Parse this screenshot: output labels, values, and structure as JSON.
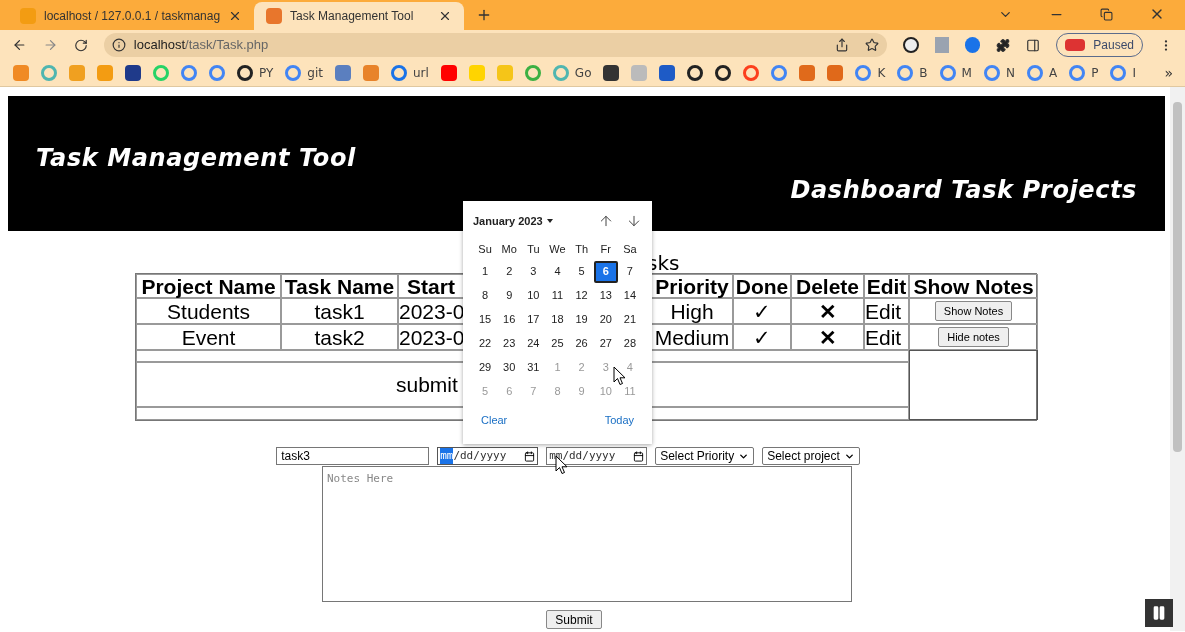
{
  "browser": {
    "tabs": [
      {
        "title": "localhost / 127.0.0.1 / taskmanag",
        "selected": false
      },
      {
        "title": "Task Management Tool",
        "selected": true
      }
    ],
    "address": {
      "host": "localhost",
      "path": "/task/Task.php"
    },
    "profile": {
      "label": "Paused"
    },
    "bookmarks": [
      {
        "kind": "square",
        "color": "#f08a24"
      },
      {
        "kind": "circle",
        "color": "#4fb6b0"
      },
      {
        "kind": "square",
        "color": "#f0a020"
      },
      {
        "kind": "square",
        "color": "#f39c12"
      },
      {
        "kind": "square",
        "color": "#1f3a8a"
      },
      {
        "kind": "circle",
        "color": "#25d366"
      },
      {
        "kind": "circle",
        "color": "#4285f4"
      },
      {
        "kind": "circle",
        "color": "#4285f4"
      },
      {
        "kind": "circle",
        "color": "#222222",
        "label": "PY"
      },
      {
        "kind": "circle",
        "color": "#4285f4",
        "label": "git"
      },
      {
        "kind": "square",
        "color": "#5b7fbf"
      },
      {
        "kind": "square",
        "color": "#e8832a"
      },
      {
        "kind": "circle",
        "color": "#1a73e8",
        "label": "url"
      },
      {
        "kind": "square",
        "color": "#ff0000"
      },
      {
        "kind": "square",
        "color": "#ffd400"
      },
      {
        "kind": "square",
        "color": "#f5c518"
      },
      {
        "kind": "circle",
        "color": "#3cb043"
      },
      {
        "kind": "circle",
        "color": "#4fb6b0",
        "label": "Go"
      },
      {
        "kind": "square",
        "color": "#333333"
      },
      {
        "kind": "square",
        "color": "#bbbbbb"
      },
      {
        "kind": "square",
        "color": "#1e5bc6"
      },
      {
        "kind": "circle",
        "color": "#222222"
      },
      {
        "kind": "circle",
        "color": "#222222"
      },
      {
        "kind": "circle",
        "color": "#fc3f1d"
      },
      {
        "kind": "circle",
        "color": "#4285f4"
      },
      {
        "kind": "square",
        "color": "#e06a1b"
      },
      {
        "kind": "square",
        "color": "#e0691a"
      },
      {
        "kind": "circle",
        "color": "#4285f4",
        "label": "K"
      },
      {
        "kind": "circle",
        "color": "#4285f4",
        "label": "B"
      },
      {
        "kind": "circle",
        "color": "#4285f4",
        "label": "M"
      },
      {
        "kind": "circle",
        "color": "#4285f4",
        "label": "N"
      },
      {
        "kind": "circle",
        "color": "#4285f4",
        "label": "A"
      },
      {
        "kind": "circle",
        "color": "#4285f4",
        "label": "P"
      },
      {
        "kind": "circle",
        "color": "#4285f4",
        "label": "I"
      }
    ],
    "more_bookmarks": "»"
  },
  "header": {
    "title": "Task Management Tool",
    "subtitle": "Dashboard Task Projects"
  },
  "table": {
    "caption": "sks",
    "columns": [
      "Project Name",
      "Task Name",
      "Start",
      "Priority",
      "Done",
      "Delete",
      "Edit",
      "Show Notes"
    ],
    "rows": [
      {
        "project": "Students",
        "task": "task1",
        "start": "2023-0",
        "priority": "High",
        "done": "✓",
        "delete": "✕",
        "edit": "Edit",
        "notes_button": "Show Notes"
      },
      {
        "project": "Event",
        "task": "task2",
        "start": "2023-0",
        "priority": "Medium",
        "done": "✓",
        "delete": "✕",
        "edit": "Edit",
        "notes_button": "Hide notes"
      }
    ],
    "submit_text": "submit"
  },
  "date_picker": {
    "month": "January 2023",
    "weekdays": [
      "Su",
      "Mo",
      "Tu",
      "We",
      "Th",
      "Fr",
      "Sa"
    ],
    "days": [
      {
        "label": "1",
        "muted": false,
        "selected": false
      },
      {
        "label": "2",
        "muted": false,
        "selected": false
      },
      {
        "label": "3",
        "muted": false,
        "selected": false
      },
      {
        "label": "4",
        "muted": false,
        "selected": false
      },
      {
        "label": "5",
        "muted": false,
        "selected": false
      },
      {
        "label": "6",
        "muted": false,
        "selected": true
      },
      {
        "label": "7",
        "muted": false,
        "selected": false
      },
      {
        "label": "8",
        "muted": false,
        "selected": false
      },
      {
        "label": "9",
        "muted": false,
        "selected": false
      },
      {
        "label": "10",
        "muted": false,
        "selected": false
      },
      {
        "label": "11",
        "muted": false,
        "selected": false
      },
      {
        "label": "12",
        "muted": false,
        "selected": false
      },
      {
        "label": "13",
        "muted": false,
        "selected": false
      },
      {
        "label": "14",
        "muted": false,
        "selected": false
      },
      {
        "label": "15",
        "muted": false,
        "selected": false
      },
      {
        "label": "16",
        "muted": false,
        "selected": false
      },
      {
        "label": "17",
        "muted": false,
        "selected": false
      },
      {
        "label": "18",
        "muted": false,
        "selected": false
      },
      {
        "label": "19",
        "muted": false,
        "selected": false
      },
      {
        "label": "20",
        "muted": false,
        "selected": false
      },
      {
        "label": "21",
        "muted": false,
        "selected": false
      },
      {
        "label": "22",
        "muted": false,
        "selected": false
      },
      {
        "label": "23",
        "muted": false,
        "selected": false
      },
      {
        "label": "24",
        "muted": false,
        "selected": false
      },
      {
        "label": "25",
        "muted": false,
        "selected": false
      },
      {
        "label": "26",
        "muted": false,
        "selected": false
      },
      {
        "label": "27",
        "muted": false,
        "selected": false
      },
      {
        "label": "28",
        "muted": false,
        "selected": false
      },
      {
        "label": "29",
        "muted": false,
        "selected": false
      },
      {
        "label": "30",
        "muted": false,
        "selected": false
      },
      {
        "label": "31",
        "muted": false,
        "selected": false
      },
      {
        "label": "1",
        "muted": true,
        "selected": false
      },
      {
        "label": "2",
        "muted": true,
        "selected": false
      },
      {
        "label": "3",
        "muted": true,
        "selected": false
      },
      {
        "label": "4",
        "muted": true,
        "selected": false
      },
      {
        "label": "5",
        "muted": true,
        "selected": false
      },
      {
        "label": "6",
        "muted": true,
        "selected": false
      },
      {
        "label": "7",
        "muted": true,
        "selected": false
      },
      {
        "label": "8",
        "muted": true,
        "selected": false
      },
      {
        "label": "9",
        "muted": true,
        "selected": false
      },
      {
        "label": "10",
        "muted": true,
        "selected": false
      },
      {
        "label": "11",
        "muted": true,
        "selected": false
      }
    ],
    "clear": "Clear",
    "today": "Today"
  },
  "form": {
    "task_name": "task3",
    "date_fields": [
      {
        "parts": [
          "mm",
          "/",
          "dd",
          "/",
          "yyyy"
        ],
        "focused": true
      },
      {
        "parts": [
          "mm",
          "/",
          "dd",
          "/",
          "yyyy"
        ],
        "focused": false
      }
    ],
    "selects": [
      "Select Priority",
      "Select project"
    ],
    "notes_placeholder": "Notes Here",
    "submit": "Submit"
  }
}
